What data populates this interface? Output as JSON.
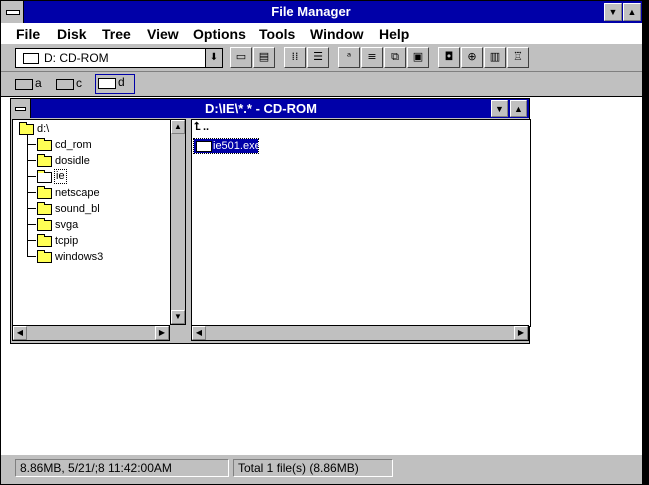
{
  "window": {
    "title": "File Manager",
    "minimize_glyph": "▼",
    "maximize_glyph": "▲"
  },
  "menu": [
    "File",
    "Disk",
    "Tree",
    "View",
    "Options",
    "Tools",
    "Window",
    "Help"
  ],
  "toolbar": {
    "drive_select": "D: CD-ROM",
    "drive_dropdown_glyph": "⬇"
  },
  "drives": [
    {
      "letter": "a",
      "type": "floppy"
    },
    {
      "letter": "c",
      "type": "hard-disk"
    },
    {
      "letter": "d",
      "type": "cd-rom",
      "selected": true
    }
  ],
  "child_window": {
    "title": "D:\\IE\\*.* - CD-ROM"
  },
  "tree": {
    "root": "d:\\",
    "folders": [
      "cd_rom",
      "dosidle",
      "ie",
      "netscape",
      "sound_bl",
      "svga",
      "tcpip",
      "windows3"
    ],
    "selected": "ie"
  },
  "files": {
    "up_label": "..",
    "items": [
      "ie501.exe"
    ],
    "selected": "ie501.exe"
  },
  "status": {
    "left": "8.86MB, 5/21/;8 11:42:00AM",
    "right": "Total 1 file(s) (8.86MB)"
  }
}
